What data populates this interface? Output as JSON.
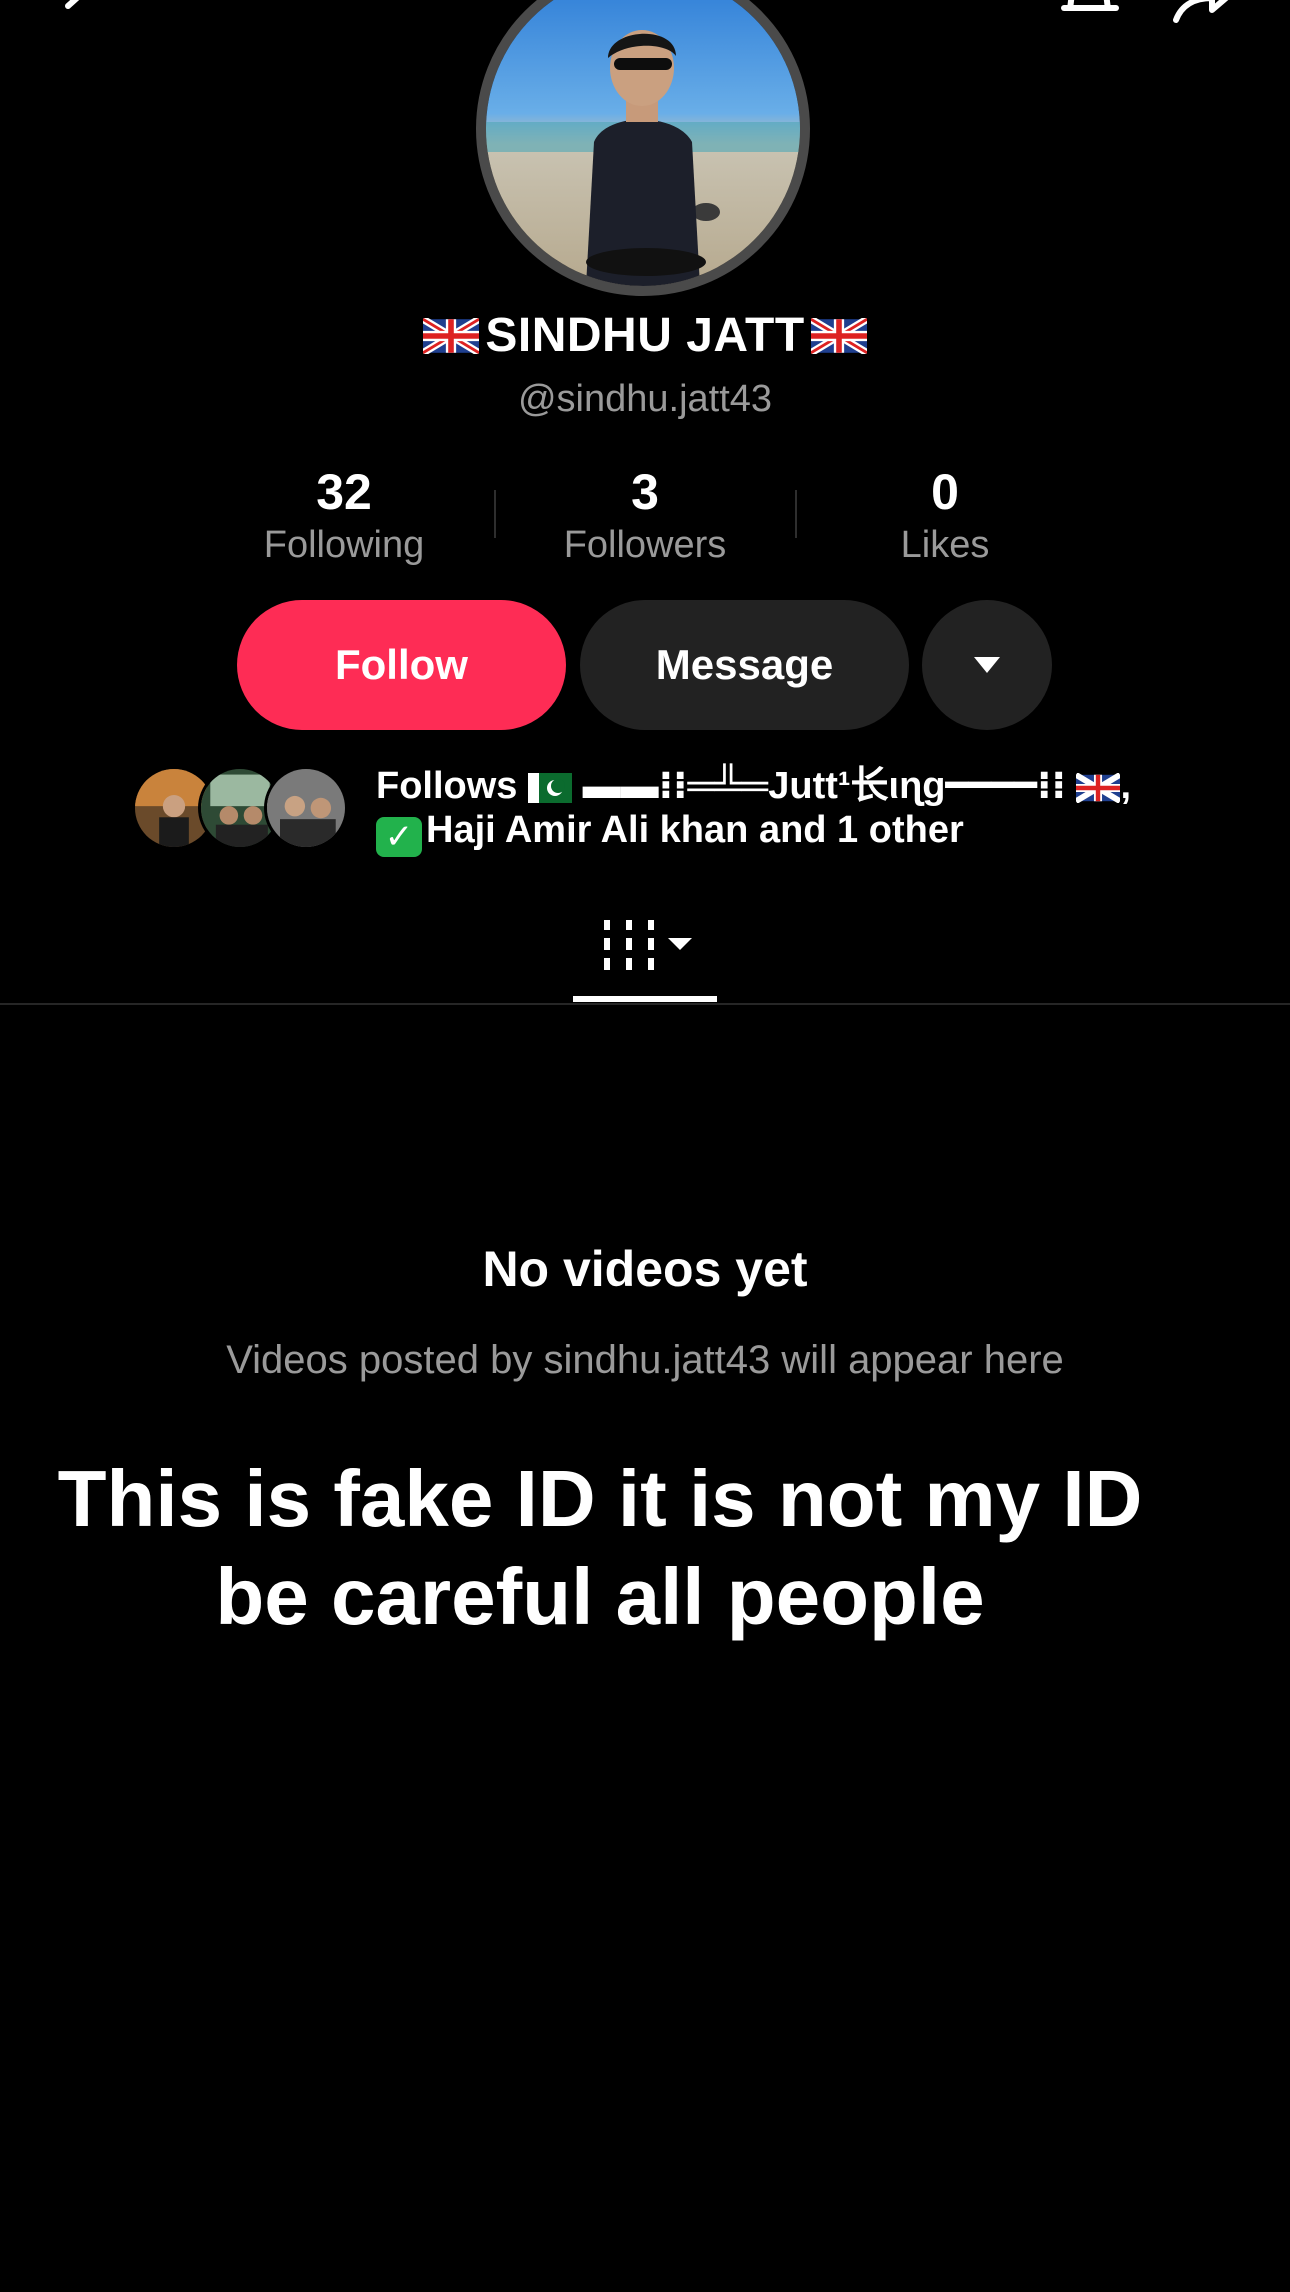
{
  "header": {
    "back_icon": "chevron-left-icon",
    "bell_icon": "bell-icon",
    "share_icon": "share-arrow-icon"
  },
  "profile": {
    "display_name": "SINDHU JATT",
    "name_flag": "uk-flag",
    "handle": "@sindhu.jatt43"
  },
  "stats": {
    "following": {
      "value": "32",
      "label": "Following"
    },
    "followers": {
      "value": "3",
      "label": "Followers"
    },
    "likes": {
      "value": "0",
      "label": "Likes"
    }
  },
  "actions": {
    "follow_label": "Follow",
    "message_label": "Message",
    "more_icon": "caret-down-icon"
  },
  "follows": {
    "prefix": "Follows",
    "name1": "▬▬⁝⁝═╩═Jutt¹长ιɳg━━━━⁝⁝",
    "separator": ",",
    "name2": "Haji Amir Ali khan",
    "suffix": "and 1 other"
  },
  "tabs": {
    "videos_icon": "grid-videos-icon",
    "dropdown_icon": "caret-down-icon"
  },
  "empty_state": {
    "title": "No videos yet",
    "subtitle": "Videos posted by sindhu.jatt43 will appear here"
  },
  "overlay_text": {
    "line1": "This is fake ID it is not my ID",
    "line2": "be careful all people"
  },
  "colors": {
    "background": "#000000",
    "follow_button": "#fe2c55",
    "secondary_button": "#222222",
    "muted_text": "#9a9a9a"
  }
}
